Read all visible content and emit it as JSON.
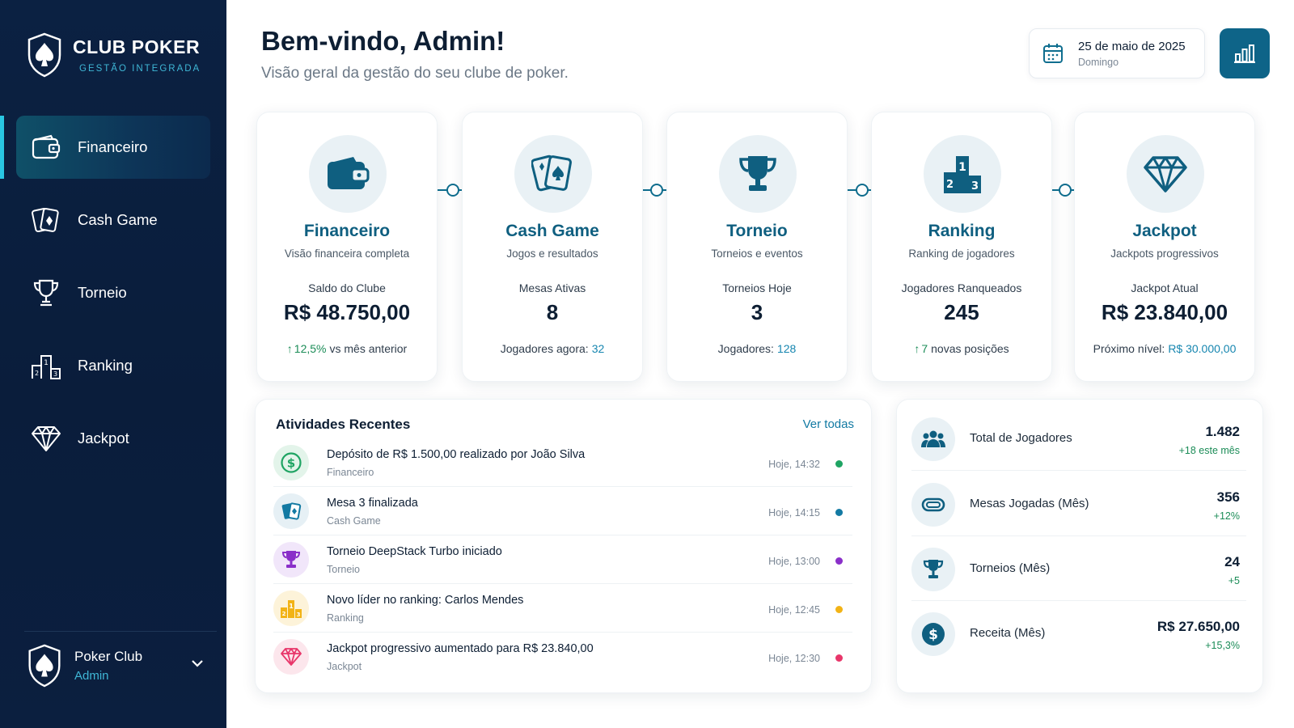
{
  "brand": {
    "title": "CLUB POKER",
    "subtitle": "GESTÃO INTEGRADA"
  },
  "nav": [
    {
      "label": "Financeiro",
      "icon": "wallet-icon",
      "active": true
    },
    {
      "label": "Cash Game",
      "icon": "cards-icon",
      "active": false
    },
    {
      "label": "Torneio",
      "icon": "trophy-icon",
      "active": false
    },
    {
      "label": "Ranking",
      "icon": "podium-icon",
      "active": false
    },
    {
      "label": "Jackpot",
      "icon": "diamond-icon",
      "active": false
    }
  ],
  "profile": {
    "name": "Poker Club",
    "role": "Admin"
  },
  "header": {
    "welcome": "Bem-vindo, Admin!",
    "subtitle": "Visão geral da gestão do seu clube de poker.",
    "date": "25 de maio de 2025",
    "weekday": "Domingo"
  },
  "modules": [
    {
      "title": "Financeiro",
      "desc": "Visão financeira completa",
      "label": "Saldo do Clube",
      "value": "R$ 48.750,00",
      "foot_arrow": "↑",
      "foot_value": "12,5%",
      "foot_text": "vs mês anterior"
    },
    {
      "title": "Cash Game",
      "desc": "Jogos e resultados",
      "label": "Mesas Ativas",
      "value": "8",
      "foot_text": "Jogadores agora:",
      "foot_value": "32"
    },
    {
      "title": "Torneio",
      "desc": "Torneios e eventos",
      "label": "Torneios Hoje",
      "value": "3",
      "foot_text": "Jogadores:",
      "foot_value": "128"
    },
    {
      "title": "Ranking",
      "desc": "Ranking de jogadores",
      "label": "Jogadores Ranqueados",
      "value": "245",
      "foot_arrow": "↑",
      "foot_value": "7",
      "foot_text": "novas posições"
    },
    {
      "title": "Jackpot",
      "desc": "Jackpots progressivos",
      "label": "Jackpot Atual",
      "value": "R$ 23.840,00",
      "foot_text": "Próximo nível:",
      "foot_value": "R$ 30.000,00"
    }
  ],
  "activities": {
    "title": "Atividades Recentes",
    "see_all": "Ver todas",
    "items": [
      {
        "text": "Depósito de R$ 1.500,00 realizado por João Silva",
        "category": "Financeiro",
        "time": "Hoje, 14:32",
        "icon": "dollar-icon",
        "color": "#1fa463"
      },
      {
        "text": "Mesa 3 finalizada",
        "category": "Cash Game",
        "time": "Hoje, 14:15",
        "icon": "cards-icon",
        "color": "#137aa3"
      },
      {
        "text": "Torneio DeepStack Turbo iniciado",
        "category": "Torneio",
        "time": "Hoje, 13:00",
        "icon": "trophy-icon",
        "color": "#8a2fc9"
      },
      {
        "text": "Novo líder no ranking: Carlos Mendes",
        "category": "Ranking",
        "time": "Hoje, 12:45",
        "icon": "podium-icon",
        "color": "#f2b316"
      },
      {
        "text": "Jackpot progressivo aumentado para R$ 23.840,00",
        "category": "Jackpot",
        "time": "Hoje, 12:30",
        "icon": "diamond-icon",
        "color": "#e8366a"
      }
    ]
  },
  "stats": [
    {
      "label": "Total de Jogadores",
      "value": "1.482",
      "delta": "+18 este mês",
      "icon": "users-icon"
    },
    {
      "label": "Mesas Jogadas (Mês)",
      "value": "356",
      "delta": "+12%",
      "icon": "table-icon"
    },
    {
      "label": "Torneios (Mês)",
      "value": "24",
      "delta": "+5",
      "icon": "trophy-icon"
    },
    {
      "label": "Receita (Mês)",
      "value": "R$ 27.650,00",
      "delta": "+15,3%",
      "icon": "dollar-icon"
    }
  ],
  "colors": {
    "sidebar": "#0b2142",
    "accent": "#0f6e8f",
    "accent_light": "#29c7e3",
    "positive": "#1b8c57"
  }
}
